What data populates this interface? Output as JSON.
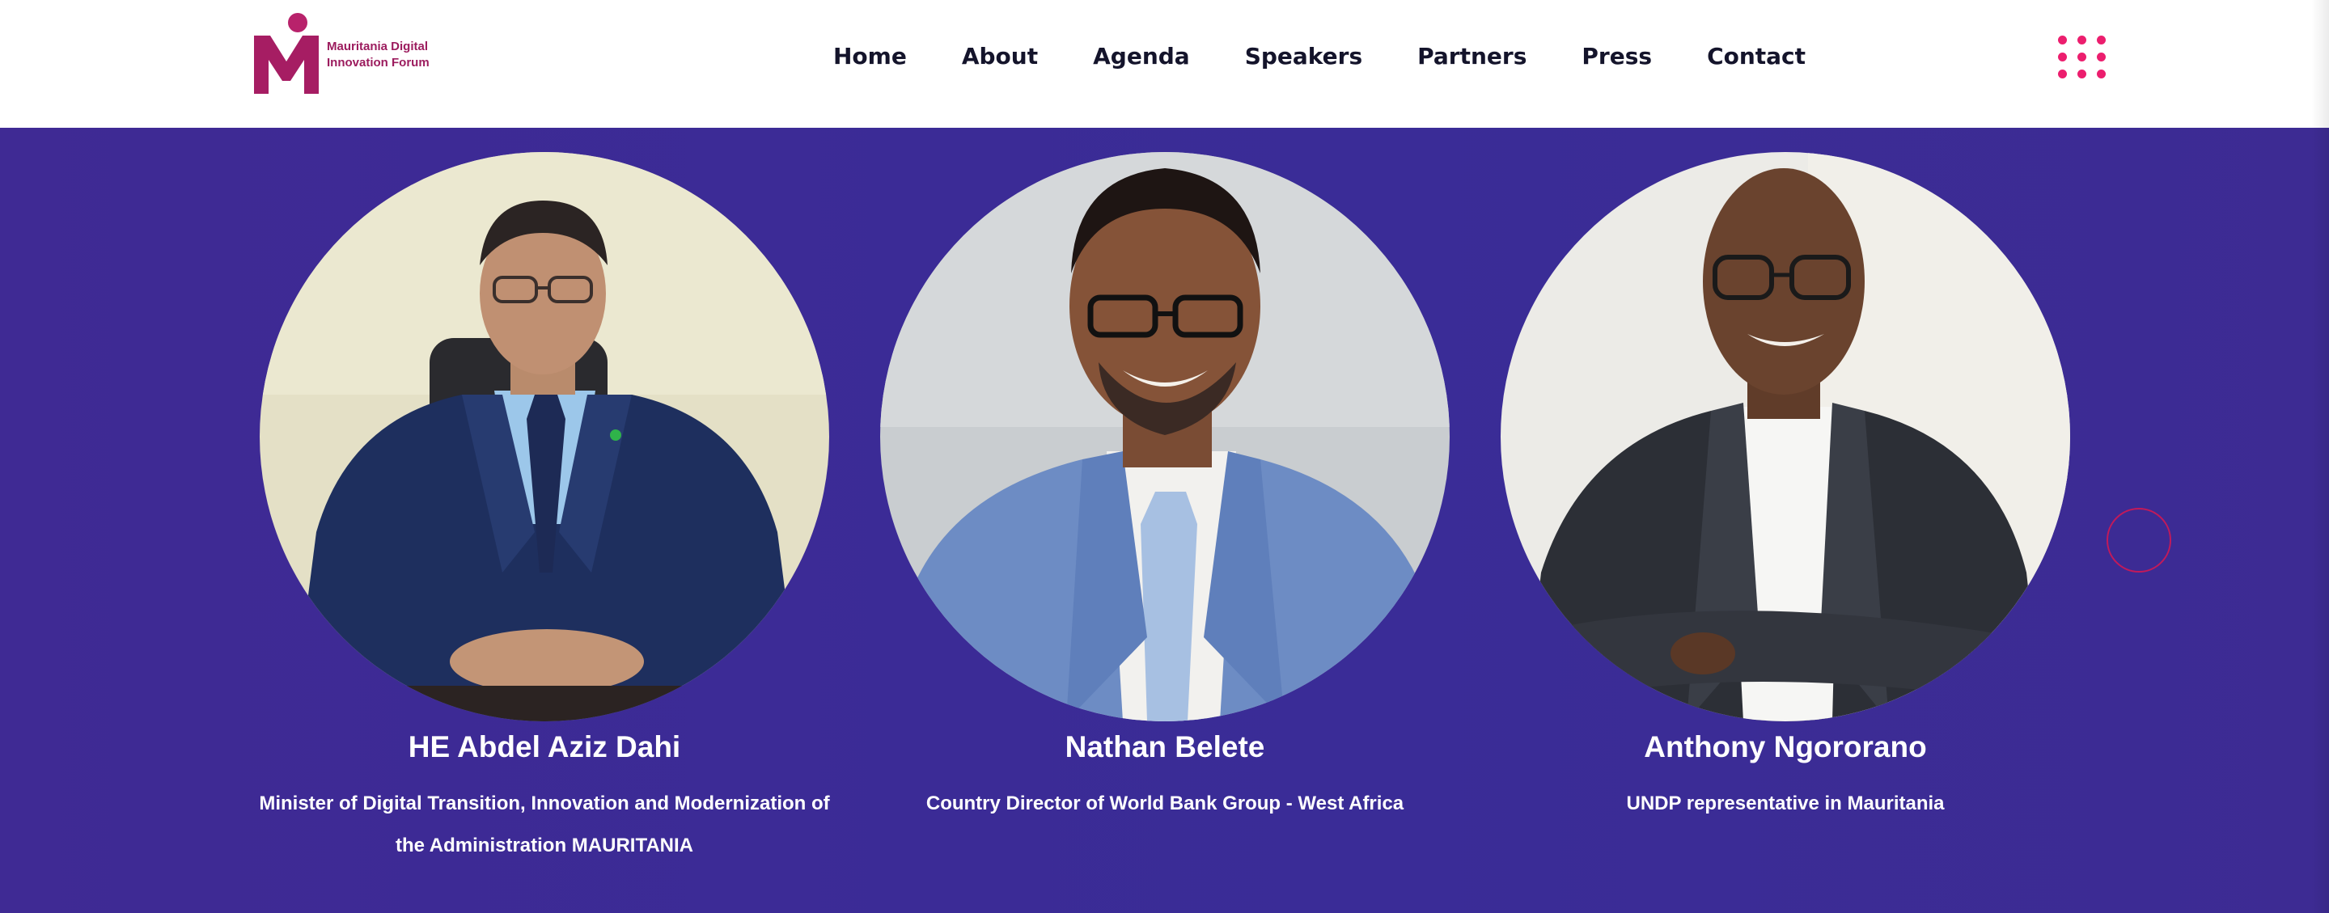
{
  "brand": {
    "name_line1": "Mauritania Digital",
    "name_line2": "Innovation Forum",
    "color": "#9c1c5e"
  },
  "nav": {
    "items": [
      {
        "label": "Home"
      },
      {
        "label": "About"
      },
      {
        "label": "Agenda"
      },
      {
        "label": "Speakers"
      },
      {
        "label": "Partners"
      },
      {
        "label": "Press"
      },
      {
        "label": "Contact"
      }
    ],
    "menu_icon": "grid-dots-icon",
    "accent": "#ec1e6e"
  },
  "speakers": {
    "background": "#3d2b95",
    "items": [
      {
        "name": "HE Abdel Aziz Dahi",
        "role_line1": "Minister of Digital Transition, Innovation and Modernization of",
        "role_line2": "the Administration MAURITANIA"
      },
      {
        "name": "Nathan Belete",
        "role_line1": "Country Director of World Bank Group - West Africa",
        "role_line2": ""
      },
      {
        "name": "Anthony Ngororano",
        "role_line1": "UNDP representative in Mauritania",
        "role_line2": ""
      }
    ]
  }
}
